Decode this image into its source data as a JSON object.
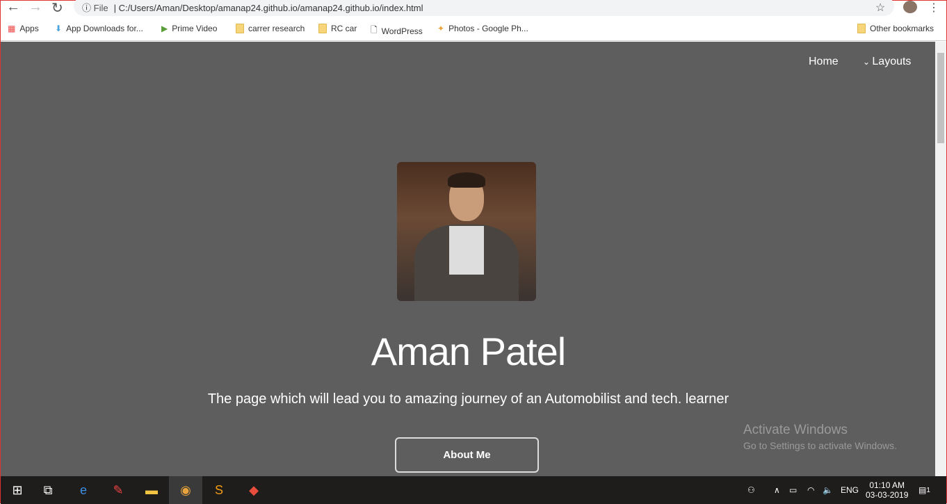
{
  "browser": {
    "url_prefix": "File",
    "url": "C:/Users/Aman/Desktop/amanap24.github.io/amanap24.github.io/index.html",
    "bookmarks": [
      "Apps",
      "App Downloads for...",
      "Prime Video",
      "carrer research",
      "RC car",
      "WordPress",
      "Photos - Google Ph..."
    ],
    "other_bookmarks": "Other bookmarks"
  },
  "nav": {
    "home": "Home",
    "layouts": "Layouts"
  },
  "hero": {
    "name": "Aman Patel",
    "tagline": "The page which will lead you to amazing journey of an Automobilist and tech. learner",
    "button": "About Me"
  },
  "watermark": {
    "title": "Activate Windows",
    "subtitle": "Go to Settings to activate Windows."
  },
  "taskbar": {
    "lang": "ENG",
    "time": "01:10 AM",
    "date": "03-03-2019",
    "notifications": "1"
  }
}
